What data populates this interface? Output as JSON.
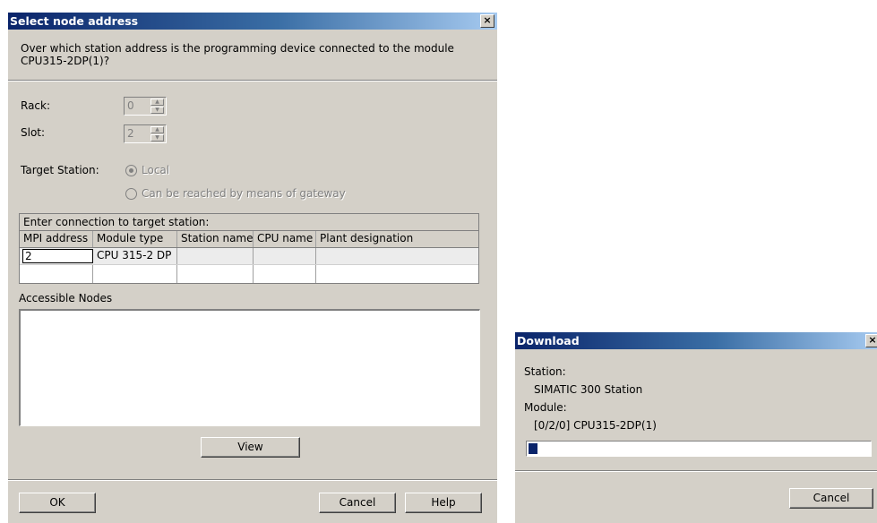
{
  "select_dialog": {
    "title": "Select node address",
    "close_glyph": "×",
    "prompt_line1": "Over which station address is the programming device connected to the module",
    "prompt_line2": "CPU315-2DP(1)?",
    "rack_label": "Rack:",
    "rack_value": "0",
    "slot_label": "Slot:",
    "slot_value": "2",
    "target_station_label": "Target Station:",
    "option_local": "Local",
    "option_gateway": "Can be reached by means of gateway",
    "connection_group_label": "Enter connection to target station:",
    "columns": [
      "MPI address",
      "Module type",
      "Station name",
      "CPU name",
      "Plant designation"
    ],
    "row": {
      "mpi_address": "2",
      "module_type": "CPU 315-2 DP",
      "station_name": "",
      "cpu_name": "",
      "plant_designation": ""
    },
    "accessible_nodes_label": "Accessible Nodes",
    "view_button": "View",
    "ok_button": "OK",
    "cancel_button": "Cancel",
    "help_button": "Help"
  },
  "download_dialog": {
    "title": "Download",
    "close_glyph": "×",
    "station_label": "Station:",
    "station_value": "SIMATIC 300 Station",
    "module_label": "Module:",
    "module_value": "[0/2/0] CPU315-2DP(1)",
    "progress_fraction": 0.025,
    "cancel_button": "Cancel"
  },
  "colors": {
    "title_start": "#0a246a",
    "title_end": "#a6caf0",
    "dialog_face": "#d4d0c8",
    "progress_fill": "#0a246a"
  }
}
